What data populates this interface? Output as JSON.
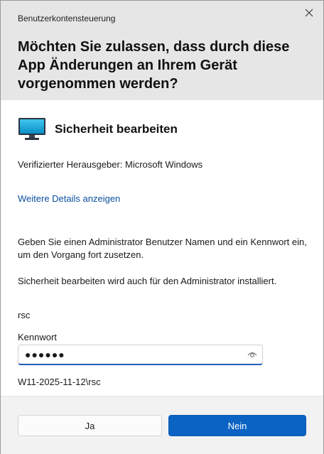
{
  "window": {
    "title": "Benutzerkontensteuerung"
  },
  "prompt": {
    "question": "Möchten Sie zulassen, dass durch diese App Änderungen an Ihrem Gerät vorgenommen werden?"
  },
  "app": {
    "name": "Sicherheit bearbeiten",
    "icon": "monitor-icon",
    "publisher": "Verifizierter Herausgeber: Microsoft Windows",
    "details_link": "Weitere Details anzeigen"
  },
  "credentials": {
    "instruction": "Geben Sie einen Administrator Benutzer Namen und ein Kennwort ein, um den Vorgang fort zusetzen.",
    "install_note": "Sicherheit bearbeiten wird auch für den Administrator installiert.",
    "username": "rsc",
    "password_label": "Kennwort",
    "password_value": "●●●●●●",
    "domain": "W11-2025-11-12\\rsc"
  },
  "buttons": {
    "yes": "Ja",
    "no": "Nein"
  },
  "colors": {
    "header_bg": "#e6e6e6",
    "link": "#0a4f9e",
    "primary_button": "#0b63c4",
    "footer_bg": "#f2f2f2"
  }
}
